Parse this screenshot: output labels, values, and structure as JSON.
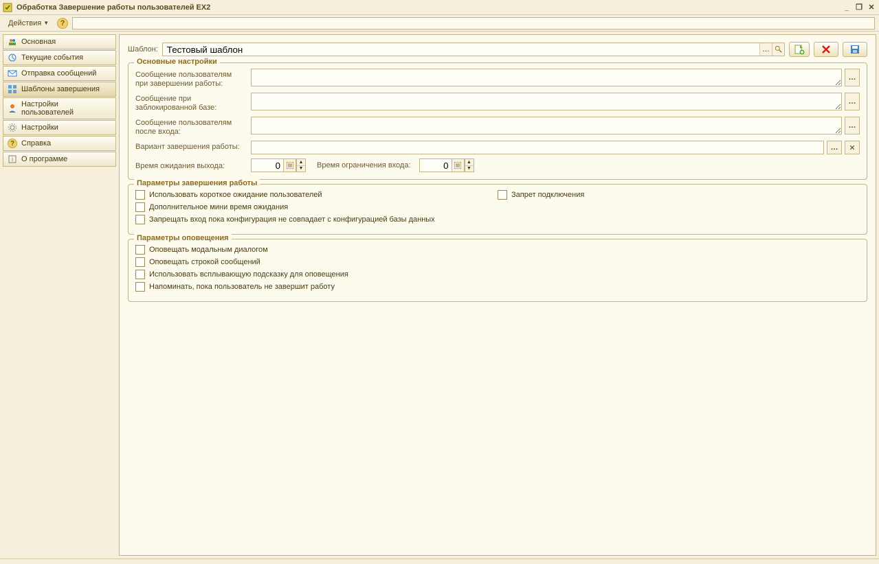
{
  "window": {
    "title": "Обработка  Завершение работы пользователей EX2"
  },
  "toolbar": {
    "actions_label": "Действия"
  },
  "sidebar": {
    "items": [
      {
        "label": "Основная"
      },
      {
        "label": "Текущие события"
      },
      {
        "label": "Отправка сообщений"
      },
      {
        "label": "Шаблоны завершения"
      },
      {
        "label": "Настройки пользователей"
      },
      {
        "label": "Настройки"
      },
      {
        "label": "Справка"
      },
      {
        "label": "О программе"
      }
    ]
  },
  "content": {
    "template_label": "Шаблон:",
    "template_value": "Тестовый шаблон",
    "group_main": {
      "legend": "Основные настройки",
      "msg_on_exit_label": "Сообщение пользователям при завершении работы:",
      "msg_locked_label": "Сообщение при заблокированной базе:",
      "msg_after_login_label": "Сообщение пользователям после входа:",
      "exit_mode_label": "Вариант завершения работы:",
      "wait_exit_label": "Время ожидания выхода:",
      "wait_exit_value": "0",
      "login_limit_label": "Время ограничения входа:",
      "login_limit_value": "0"
    },
    "group_exit": {
      "legend": "Параметры завершения работы",
      "short_wait": "Использовать короткое ожидание пользователей",
      "deny_connect": "Запрет подключения",
      "extra_mini": "Дополнительное мини время ожидания",
      "deny_until_conf": "Запрещать вход пока конфигурация не совпадает с конфигурацией базы данных"
    },
    "group_notify": {
      "legend": "Параметры оповещения",
      "modal": "Оповещать модальным диалогом",
      "msgline": "Оповещать строкой сообщений",
      "popup": "Использовать всплывающую подсказку для оповещения",
      "remind": "Напоминать, пока пользователь не завершит работу"
    }
  }
}
